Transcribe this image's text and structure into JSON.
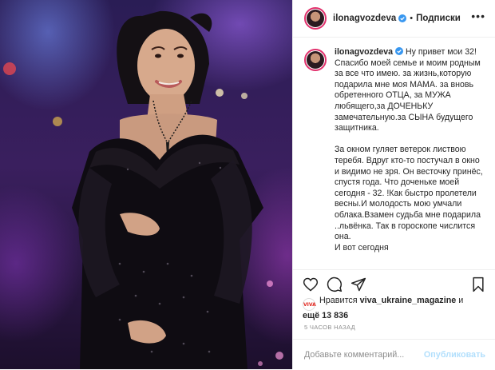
{
  "post": {
    "username": "ilonagvozdeva",
    "follow_label": "Подписки",
    "more_label": "•••",
    "caption": "Ну привет мои 32! Спасибо моей семье и моим родным за все что имею. за жизнь,которую подарила мне моя МАМА. за вновь обретенного ОТЦА, за МУЖА любящего,за ДОЧЕНЬКУ замечательную.за СЫНА будущего защитника.\n\nЗа окном гуляет ветерок листвою теребя. Вдруг кто-то постучал в окно и видимо не зря. Он весточку принёс, спустя года. Что доченьке моей сегодня - 32. !Как быстро пролетели весны.И молодость мою умчали облака.Взамен судьба мне подарила ..львёнка. Так в гороскопе числится она.\nИ вот сегодня",
    "likes_prefix": "Нравится",
    "likes_user": "viva_ukraine_magazine",
    "likes_and": "и",
    "likes_more": "ещё 13 836",
    "liker_badge": "VIVA",
    "timestamp": "5 ЧАСОВ НАЗАД",
    "comment_placeholder": "Добавьте комментарий...",
    "post_button": "Опубликовать"
  },
  "icons": {
    "like": "heart-icon",
    "comment": "comment-icon",
    "share": "share-icon",
    "save": "bookmark-icon",
    "verified": "verified-badge-icon",
    "photo": "post-photo"
  },
  "colors": {
    "verified": "#3897f0",
    "story_ring": "#e1306c",
    "post_disabled": "#b2dffc",
    "muted": "#8e8e8e"
  }
}
